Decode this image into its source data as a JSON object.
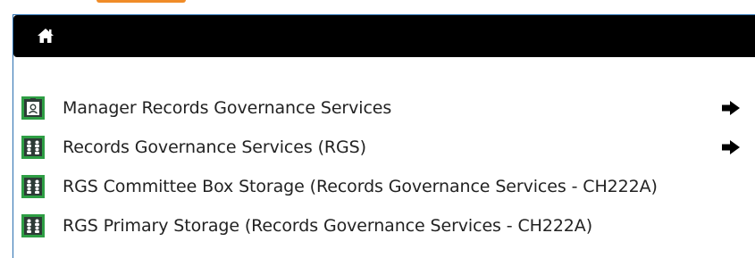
{
  "header": {
    "home_icon": "home-icon"
  },
  "items": [
    {
      "label": "Manager Records Governance Services",
      "icon": "manager-badge-icon",
      "has_arrow": true
    },
    {
      "label": "Records Governance Services (RGS)",
      "icon": "group-users-icon",
      "has_arrow": true
    },
    {
      "label": "RGS Committee Box Storage (Records Governance Services - CH222A)",
      "icon": "group-users-icon",
      "has_arrow": false
    },
    {
      "label": "RGS Primary Storage (Records Governance Services - CH222A)",
      "icon": "group-users-icon",
      "has_arrow": false
    }
  ],
  "colors": {
    "header_bg": "#000000",
    "icon_green": "#2e9e44",
    "icon_dark": "#2d3b36",
    "panel_border": "#2a6fb0",
    "accent_orange": "#f08c28"
  }
}
